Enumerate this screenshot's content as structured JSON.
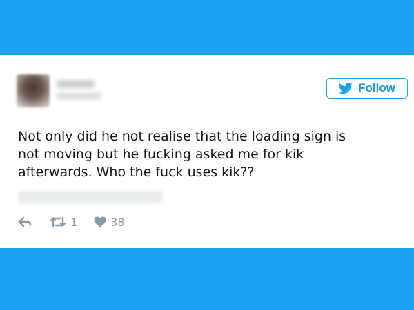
{
  "colors": {
    "background": "#1da1f2",
    "card": "#ffffff",
    "accent": "#1b95e0",
    "text": "#14171a",
    "muted": "#8899a6"
  },
  "tweet": {
    "author": {
      "name": "",
      "handle": ""
    },
    "follow_label": "Follow",
    "text": "Not only did he not realise that the loading sign is\nnot moving but he fucking asked me for kik\nafterwards. Who the fuck uses kik??",
    "timestamp": "",
    "actions": {
      "retweet_count": "1",
      "like_count": "38"
    }
  },
  "icons": [
    "bird-icon",
    "reply-icon",
    "retweet-icon",
    "heart-icon"
  ]
}
